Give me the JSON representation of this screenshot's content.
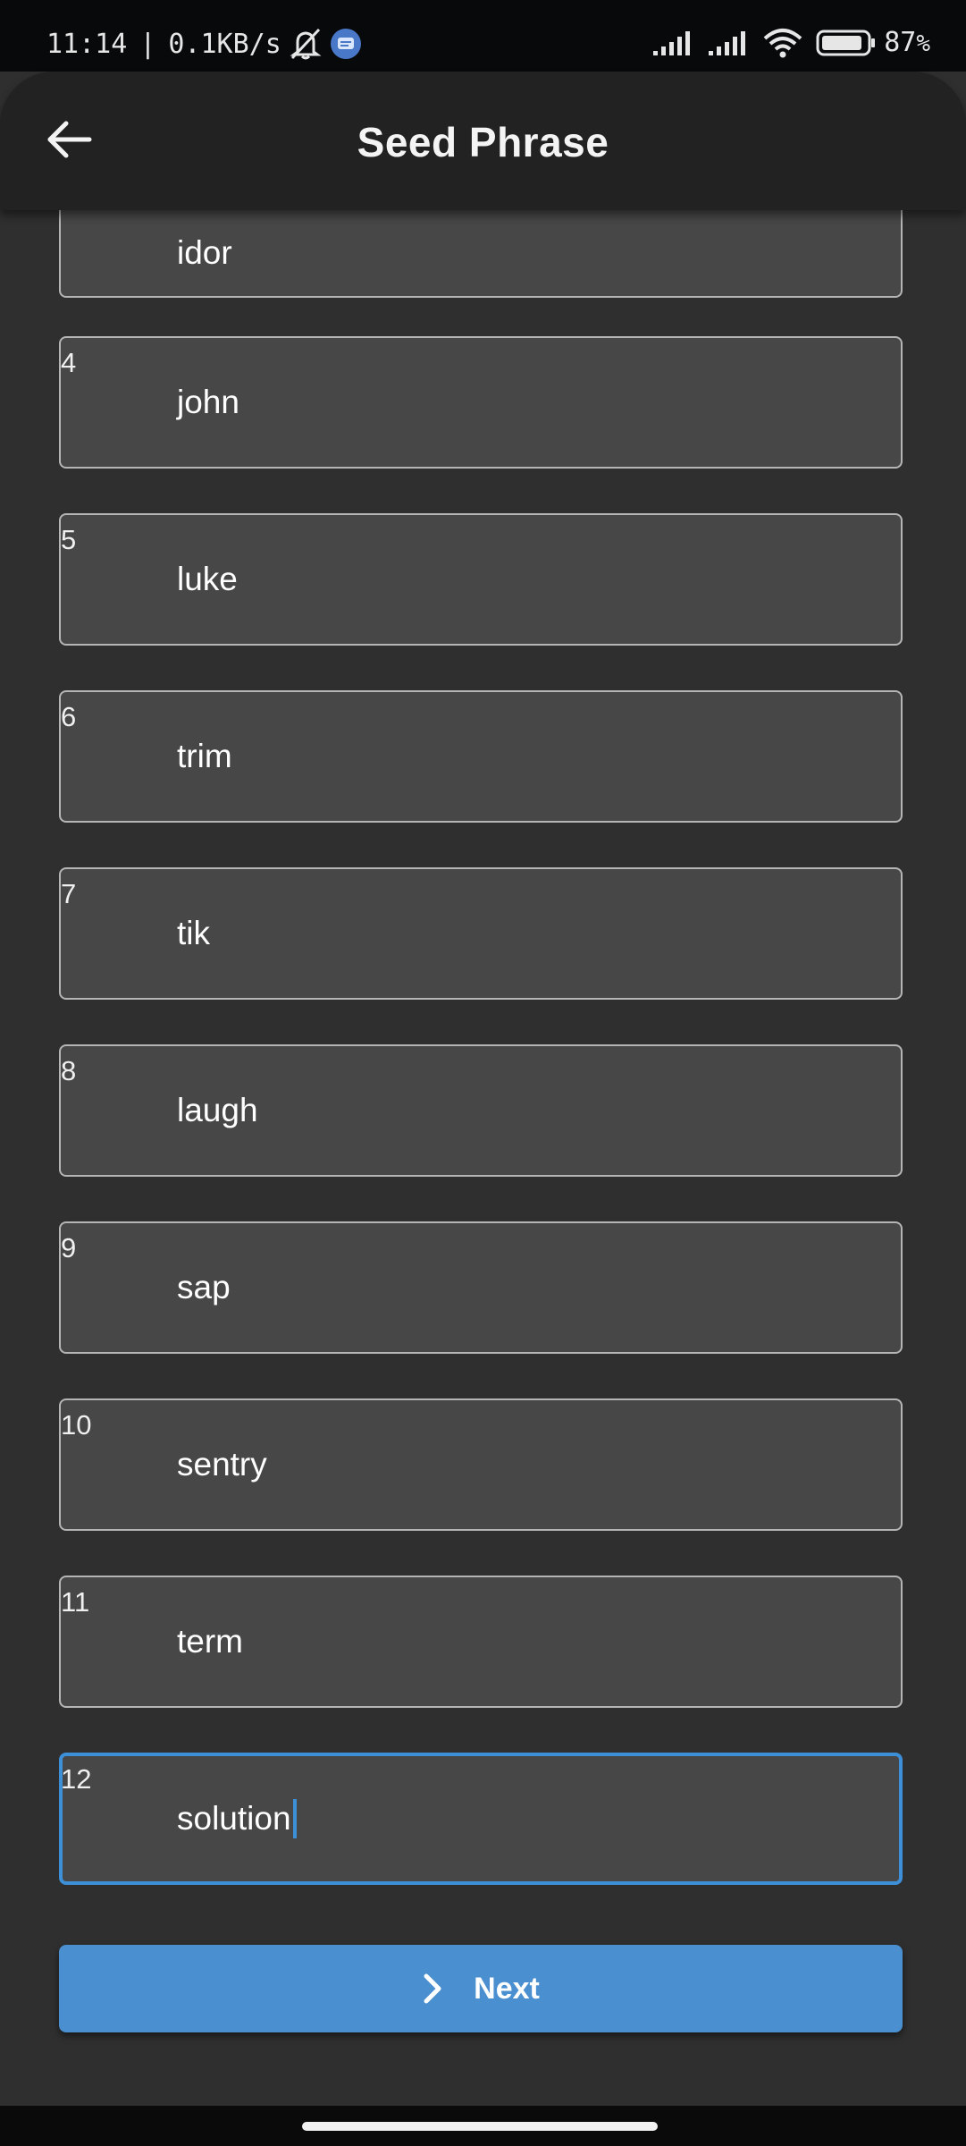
{
  "status_bar": {
    "time": "11:14",
    "separator": "|",
    "speed": "0.1KB/s",
    "battery": "87",
    "battery_unit": "%"
  },
  "header": {
    "title": "Seed Phrase",
    "back_icon": "arrow-left-icon"
  },
  "fields": [
    {
      "index": "",
      "value": "idor"
    },
    {
      "index": "4",
      "value": "john"
    },
    {
      "index": "5",
      "value": "luke"
    },
    {
      "index": "6",
      "value": "trim"
    },
    {
      "index": "7",
      "value": "tik"
    },
    {
      "index": "8",
      "value": "laugh"
    },
    {
      "index": "9",
      "value": "sap"
    },
    {
      "index": "10",
      "value": "sentry"
    },
    {
      "index": "11",
      "value": "term"
    },
    {
      "index": "12",
      "value": "solution"
    }
  ],
  "next_button": {
    "label": "Next",
    "icon": "chevron-right-icon"
  },
  "colors": {
    "background": "#2f2f2f",
    "app_bar": "#222222",
    "field_bg": "#474747",
    "accent": "#4a8fd0"
  }
}
